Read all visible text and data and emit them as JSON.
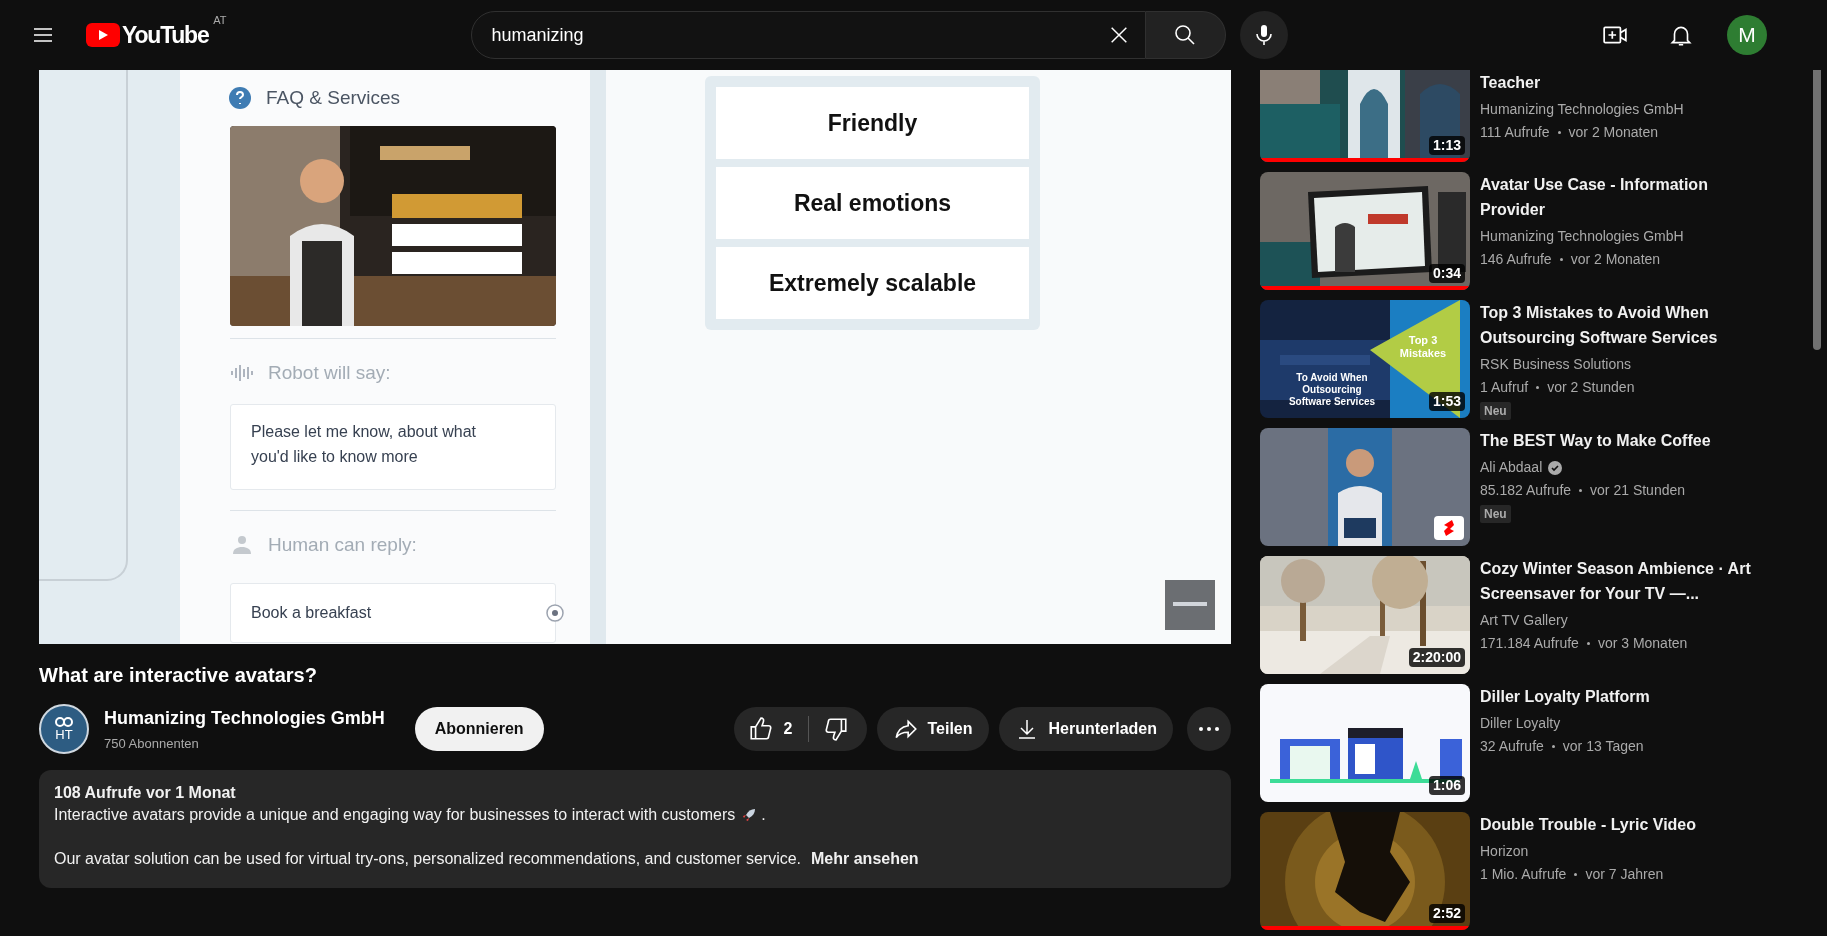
{
  "header": {
    "logo": "YouTube",
    "country": "AT",
    "search": {
      "value": "humanizing"
    },
    "avatar_letter": "M"
  },
  "video_frame": {
    "card_title": "FAQ & Services",
    "robot_label": "Robot will say:",
    "robot_text": "Please let me know, about what you'd like to know more",
    "human_label": "Human can reply:",
    "reply": "Book a breakfast",
    "features": [
      "Friendly",
      "Real emotions",
      "Extremely scalable"
    ]
  },
  "video": {
    "title": "What are interactive avatars?",
    "channel": {
      "name": "Humanizing Technologies GmbH",
      "subscribers": "750 Abonnenten",
      "avatar": "HT"
    },
    "subscribe": "Abonnieren",
    "likes": "2",
    "share": "Teilen",
    "download": "Herunterladen",
    "description": {
      "meta": "108 Aufrufe  vor 1 Monat",
      "line_1": "Interactive avatars provide a unique and engaging way for businesses to interact with customers",
      "line_1_end": ".",
      "line_2": "Our avatar solution can be used for virtual try-ons, personalized recommendations, and customer service.",
      "more": "Mehr ansehen"
    }
  },
  "sidebar": {
    "items": [
      {
        "title": "Teacher",
        "channel": "Humanizing Technologies GmbH",
        "verified": false,
        "views": "111 Aufrufe",
        "age": "vor 2 Monaten",
        "duration": "1:13",
        "level": 1
      },
      {
        "title": "Avatar Use Case - Information Provider",
        "channel": "Humanizing Technologies GmbH",
        "verified": false,
        "views": "146 Aufrufe",
        "age": "vor 2 Monaten",
        "duration": "0:34",
        "level": 1
      },
      {
        "title": "Top 3 Mistakes to Avoid When Outsourcing Software Services",
        "channel": "RSK Business Solutions",
        "verified": false,
        "views": "1 Aufruf",
        "age": "vor 2 Stunden",
        "duration": "1:53",
        "badge": "Neu",
        "thumb_texts": [
          "Top 3 Mistakes",
          "To Avoid When Outsourcing Software Services"
        ]
      },
      {
        "title": "The BEST Way to Make Coffee",
        "channel": "Ali Abdaal",
        "verified": true,
        "views": "85.182 Aufrufe",
        "age": "vor 21 Stunden",
        "shorts": true,
        "badge": "Neu"
      },
      {
        "title": "Cozy Winter Season Ambience · Art Screensaver for Your TV —...",
        "channel": "Art TV Gallery",
        "verified": false,
        "views": "171.184 Aufrufe",
        "age": "vor 3 Monaten",
        "duration": "2:20:00"
      },
      {
        "title": "Diller Loyalty Platform",
        "channel": "Diller Loyalty",
        "verified": false,
        "views": "32 Aufrufe",
        "age": "vor 13 Tagen",
        "duration": "1:06"
      },
      {
        "title": "Double Trouble - Lyric Video",
        "channel": "Horizon",
        "verified": false,
        "views": "1 Mio. Aufrufe",
        "age": "vor 7 Jahren",
        "duration": "2:52",
        "level": 1
      }
    ]
  }
}
